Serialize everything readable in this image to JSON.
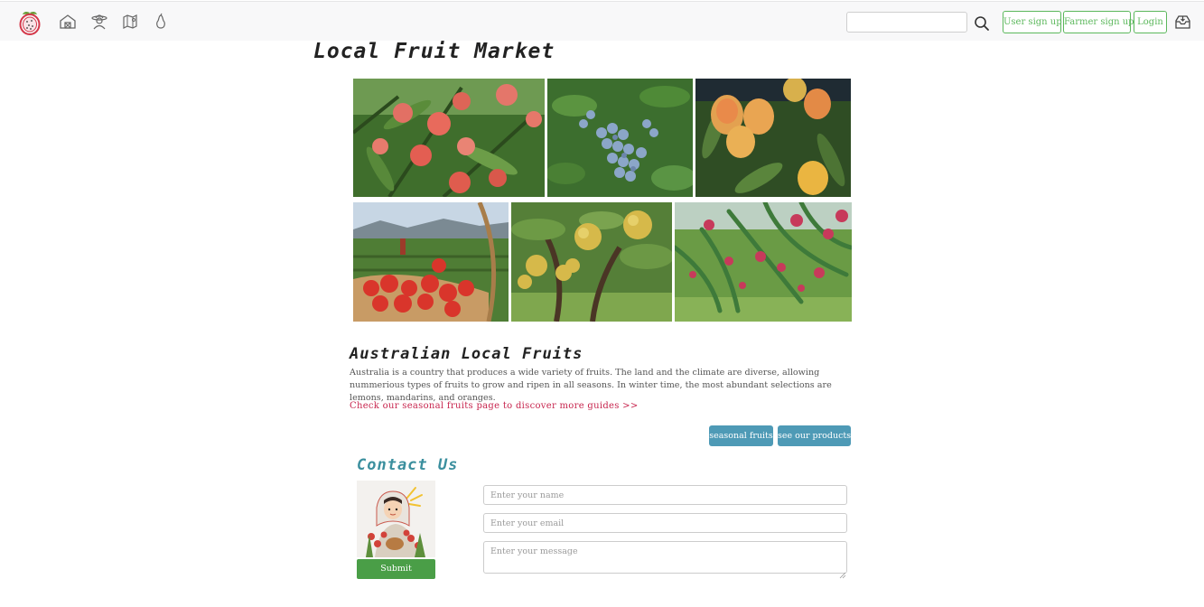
{
  "nav": {
    "logo": "dragonfruit-logo",
    "icons": [
      "farm-icon",
      "farmer-icon",
      "map-icon",
      "pear-icon"
    ],
    "search": {
      "placeholder": "",
      "value": ""
    },
    "buttons": {
      "user_signup": "User sign up",
      "farmer_signup": "Farmer sign up",
      "login": "Login"
    },
    "inbox_icon": "inbox-icon"
  },
  "page": {
    "title": "Local Fruit Market"
  },
  "gallery": {
    "images": [
      "peaches-icon",
      "blueberries-icon",
      "mangoes-icon",
      "strawberries-icon",
      "pears-icon",
      "dragonfruit-icon"
    ]
  },
  "about": {
    "title": "Australian Local Fruits",
    "text": "Australia is a country that produces a wide variety of fruits. The land and the climate are diverse, allowing nummerious types of fruits to grow and ripen in all seasons. In winter time, the most abundant selections are lemons, mandarins, and oranges.",
    "link": "Check our seasonal fruits page to discover more guides >>",
    "buttons": {
      "seasonal": "seasonal fruits",
      "products": "see our products"
    }
  },
  "contact": {
    "title": "Contact Us",
    "name_placeholder": "Enter your name",
    "email_placeholder": "Enter your email",
    "message_placeholder": "Enter your message",
    "submit": "Submit"
  },
  "colors": {
    "nav_bg": "#f8f8f9",
    "green": "#5cb85c",
    "teal_button": "#4e9ab6",
    "link_red": "#c7254e",
    "contact_title": "#3b8f9e",
    "submit_green": "#4a9e47"
  }
}
